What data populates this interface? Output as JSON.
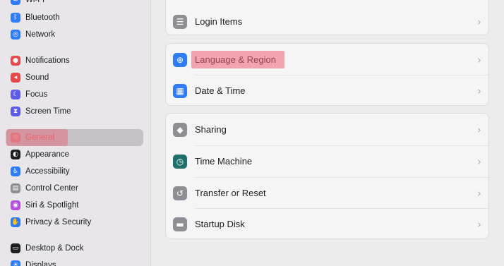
{
  "sidebar": {
    "items": [
      {
        "label": "Wi-Fi",
        "icon": "wifi-icon",
        "color": "#2f7cf6",
        "glyph": "≋"
      },
      {
        "label": "Bluetooth",
        "icon": "bluetooth-icon",
        "color": "#2f7cf6",
        "glyph": "ᛒ"
      },
      {
        "label": "Network",
        "icon": "network-icon",
        "color": "#2f7cf6",
        "glyph": "◎"
      },
      {
        "label": "Notifications",
        "icon": "notifications-icon",
        "color": "#e5494e",
        "glyph": "●"
      },
      {
        "label": "Sound",
        "icon": "sound-icon",
        "color": "#e5494e",
        "glyph": "◂"
      },
      {
        "label": "Focus",
        "icon": "focus-icon",
        "color": "#5e5ce6",
        "glyph": "☾"
      },
      {
        "label": "Screen Time",
        "icon": "screen-time-icon",
        "color": "#5e5ce6",
        "glyph": "⧗"
      },
      {
        "label": "General",
        "icon": "gear-icon",
        "color": "#8e8e93",
        "glyph": "⚙"
      },
      {
        "label": "Appearance",
        "icon": "appearance-icon",
        "color": "#1d1d1f",
        "glyph": "◐"
      },
      {
        "label": "Accessibility",
        "icon": "accessibility-icon",
        "color": "#2f7cf6",
        "glyph": "♿"
      },
      {
        "label": "Control Center",
        "icon": "control-center-icon",
        "color": "#8e8e93",
        "glyph": "▤"
      },
      {
        "label": "Siri & Spotlight",
        "icon": "siri-icon",
        "color": "#b44fd8",
        "glyph": "◉"
      },
      {
        "label": "Privacy & Security",
        "icon": "privacy-hand-icon",
        "color": "#2f7cf6",
        "glyph": "✋"
      },
      {
        "label": "Desktop & Dock",
        "icon": "desktop-dock-icon",
        "color": "#1d1d1f",
        "glyph": "▭"
      },
      {
        "label": "Displays",
        "icon": "displays-icon",
        "color": "#2f7cf6",
        "glyph": "☀"
      }
    ],
    "selected": "General"
  },
  "main": {
    "groups": [
      {
        "rows": [
          {
            "label": "Login Items",
            "icon": "login-items-icon",
            "color": "#8e8e93",
            "glyph": "☰"
          }
        ]
      },
      {
        "rows": [
          {
            "label": "Language & Region",
            "icon": "globe-icon",
            "color": "#2f7cf6",
            "glyph": "⊕"
          },
          {
            "label": "Date & Time",
            "icon": "calendar-clock-icon",
            "color": "#2f7cf6",
            "glyph": "▦"
          }
        ]
      },
      {
        "rows": [
          {
            "label": "Sharing",
            "icon": "sharing-icon",
            "color": "#8e8e93",
            "glyph": "◆"
          },
          {
            "label": "Time Machine",
            "icon": "time-machine-icon",
            "color": "#1f6f6a",
            "glyph": "◷"
          },
          {
            "label": "Transfer or Reset",
            "icon": "reset-icon",
            "color": "#8e8e93",
            "glyph": "↺"
          },
          {
            "label": "Startup Disk",
            "icon": "startup-disk-icon",
            "color": "#8e8e93",
            "glyph": "▬"
          }
        ]
      }
    ],
    "chevron": "›"
  }
}
